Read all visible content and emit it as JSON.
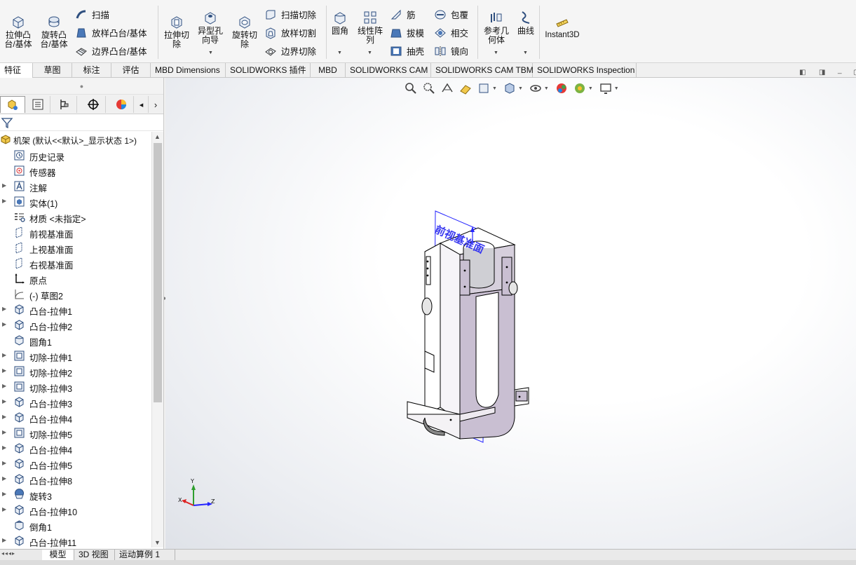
{
  "ribbon": {
    "extrude_boss": "拉伸凸\n台/基体",
    "revolve_boss": "旋转凸\n台/基体",
    "sweep": "扫描",
    "loft_boss": "放样凸台/基体",
    "boundary_boss": "边界凸台/基体",
    "extrude_cut": "拉伸切\n除",
    "hole_wizard": "异型孔\n向导",
    "revolve_cut": "旋转切\n除",
    "swept_cut": "扫描切除",
    "lofted_cut": "放样切割",
    "boundary_cut": "边界切除",
    "fillet": "圆角",
    "linear_pattern": "线性阵\n列",
    "rib": "筋",
    "draft": "拔模",
    "shell": "抽壳",
    "wrap": "包覆",
    "intersect": "相交",
    "mirror": "镜向",
    "ref_geometry": "参考几\n何体",
    "curves": "曲线",
    "instant3d": "Instant3D"
  },
  "tabs": [
    "特征",
    "草图",
    "标注",
    "评估",
    "MBD Dimensions",
    "SOLIDWORKS 插件",
    "MBD",
    "SOLIDWORKS CAM",
    "SOLIDWORKS CAM TBM",
    "SOLIDWORKS Inspection"
  ],
  "tree": {
    "root": "机架 (默认<<默认>_显示状态 1>)",
    "items": [
      {
        "label": "历史记录",
        "icon": "history-icon",
        "expand": false
      },
      {
        "label": "传感器",
        "icon": "sensor-icon",
        "expand": false
      },
      {
        "label": "注解",
        "icon": "annotation-icon",
        "expand": true
      },
      {
        "label": "实体(1)",
        "icon": "solid-body-icon",
        "expand": true
      },
      {
        "label": "材质 <未指定>",
        "icon": "material-icon",
        "expand": false
      },
      {
        "label": "前视基准面",
        "icon": "plane-icon",
        "expand": false
      },
      {
        "label": "上视基准面",
        "icon": "plane-icon",
        "expand": false
      },
      {
        "label": "右视基准面",
        "icon": "plane-icon",
        "expand": false
      },
      {
        "label": "原点",
        "icon": "origin-icon",
        "expand": false
      },
      {
        "label": "(-) 草图2",
        "icon": "sketch-icon",
        "expand": false
      },
      {
        "label": "凸台-拉伸1",
        "icon": "extrude-icon",
        "expand": true
      },
      {
        "label": "凸台-拉伸2",
        "icon": "extrude-icon",
        "expand": true
      },
      {
        "label": "圆角1",
        "icon": "fillet-icon",
        "expand": false
      },
      {
        "label": "切除-拉伸1",
        "icon": "cut-extrude-icon",
        "expand": true
      },
      {
        "label": "切除-拉伸2",
        "icon": "cut-extrude-icon",
        "expand": true
      },
      {
        "label": "切除-拉伸3",
        "icon": "cut-extrude-icon",
        "expand": true
      },
      {
        "label": "凸台-拉伸3",
        "icon": "extrude-icon",
        "expand": true
      },
      {
        "label": "凸台-拉伸4",
        "icon": "extrude-icon",
        "expand": true
      },
      {
        "label": "切除-拉伸5",
        "icon": "cut-extrude-icon",
        "expand": true
      },
      {
        "label": "凸台-拉伸4",
        "icon": "extrude-icon",
        "expand": true
      },
      {
        "label": "凸台-拉伸5",
        "icon": "extrude-icon",
        "expand": true
      },
      {
        "label": "凸台-拉伸8",
        "icon": "extrude-icon",
        "expand": true
      },
      {
        "label": "旋转3",
        "icon": "revolve-icon",
        "expand": true
      },
      {
        "label": "凸台-拉伸10",
        "icon": "extrude-icon",
        "expand": true
      },
      {
        "label": "倒角1",
        "icon": "chamfer-icon",
        "expand": false
      },
      {
        "label": "凸台-拉伸11",
        "icon": "extrude-icon",
        "expand": true
      }
    ]
  },
  "viewport": {
    "plane_label": "前视基准面",
    "triad": {
      "x": "X",
      "y": "Y",
      "z": "Z"
    }
  },
  "bottom_tabs": [
    "模型",
    "3D 视图",
    "运动算例 1"
  ],
  "colors": {
    "part_face": "#c9bfd2",
    "highlight": "#2424ff",
    "ribbon_bg": "#f5f5f5"
  }
}
